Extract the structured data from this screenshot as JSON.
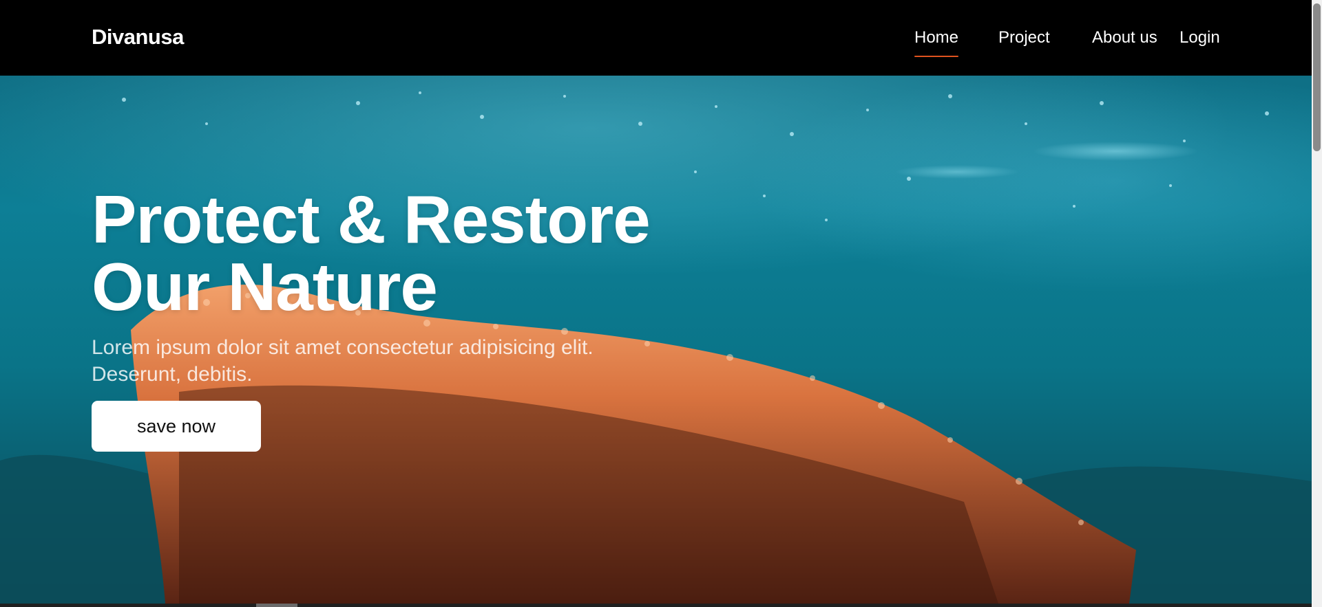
{
  "header": {
    "brand": "Divanusa",
    "nav": [
      {
        "label": "Home",
        "active": true
      },
      {
        "label": "Project",
        "active": false
      },
      {
        "label": "About us",
        "active": false
      },
      {
        "label": "Login",
        "active": false
      }
    ]
  },
  "hero": {
    "title_line1": "Protect & Restore",
    "title_line2": "Our Nature",
    "subtitle_line1": "Lorem ipsum dolor sit amet consectetur adipisicing elit.",
    "subtitle_line2": "Deserunt, debitis.",
    "cta_label": "save now",
    "background": "underwater-coral-image"
  },
  "colors": {
    "accent": "#e0531f",
    "header_bg": "#000000",
    "water": "#0d7f96",
    "coral": "#e07a45"
  }
}
